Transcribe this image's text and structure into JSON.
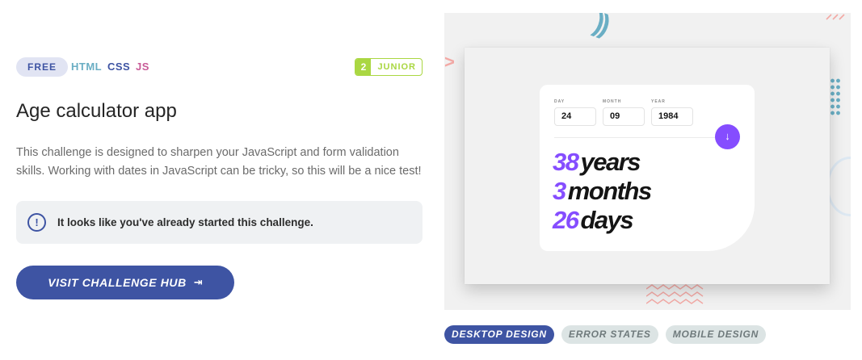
{
  "tags": {
    "free": "FREE",
    "languages": [
      "HTML",
      "CSS",
      "JS"
    ],
    "level_number": "2",
    "level_name": "JUNIOR"
  },
  "title": "Age calculator app",
  "description": "This challenge is designed to sharpen your JavaScript and form validation skills. Working with dates in JavaScript can be tricky, so this will be a nice test!",
  "notice": {
    "icon": "exclamation-circle-icon",
    "text": "It looks like you've already started this challenge."
  },
  "cta": {
    "label": "VISIT CHALLENGE HUB",
    "icon": "enter-arrow-icon"
  },
  "preview": {
    "fields": [
      {
        "label": "DAY",
        "value": "24"
      },
      {
        "label": "MONTH",
        "value": "09"
      },
      {
        "label": "YEAR",
        "value": "1984"
      }
    ],
    "submit_icon": "arrow-down-icon",
    "results": [
      {
        "number": "38",
        "unit": "years"
      },
      {
        "number": "3",
        "unit": "months"
      },
      {
        "number": "26",
        "unit": "days"
      }
    ]
  },
  "design_tabs": [
    {
      "label": "DESKTOP DESIGN",
      "active": true
    },
    {
      "label": "ERROR STATES",
      "active": false
    },
    {
      "label": "MOBILE DESIGN",
      "active": false
    }
  ],
  "colors": {
    "accent": "#3e54a3",
    "level": "#aad742",
    "purple": "#854dff"
  }
}
